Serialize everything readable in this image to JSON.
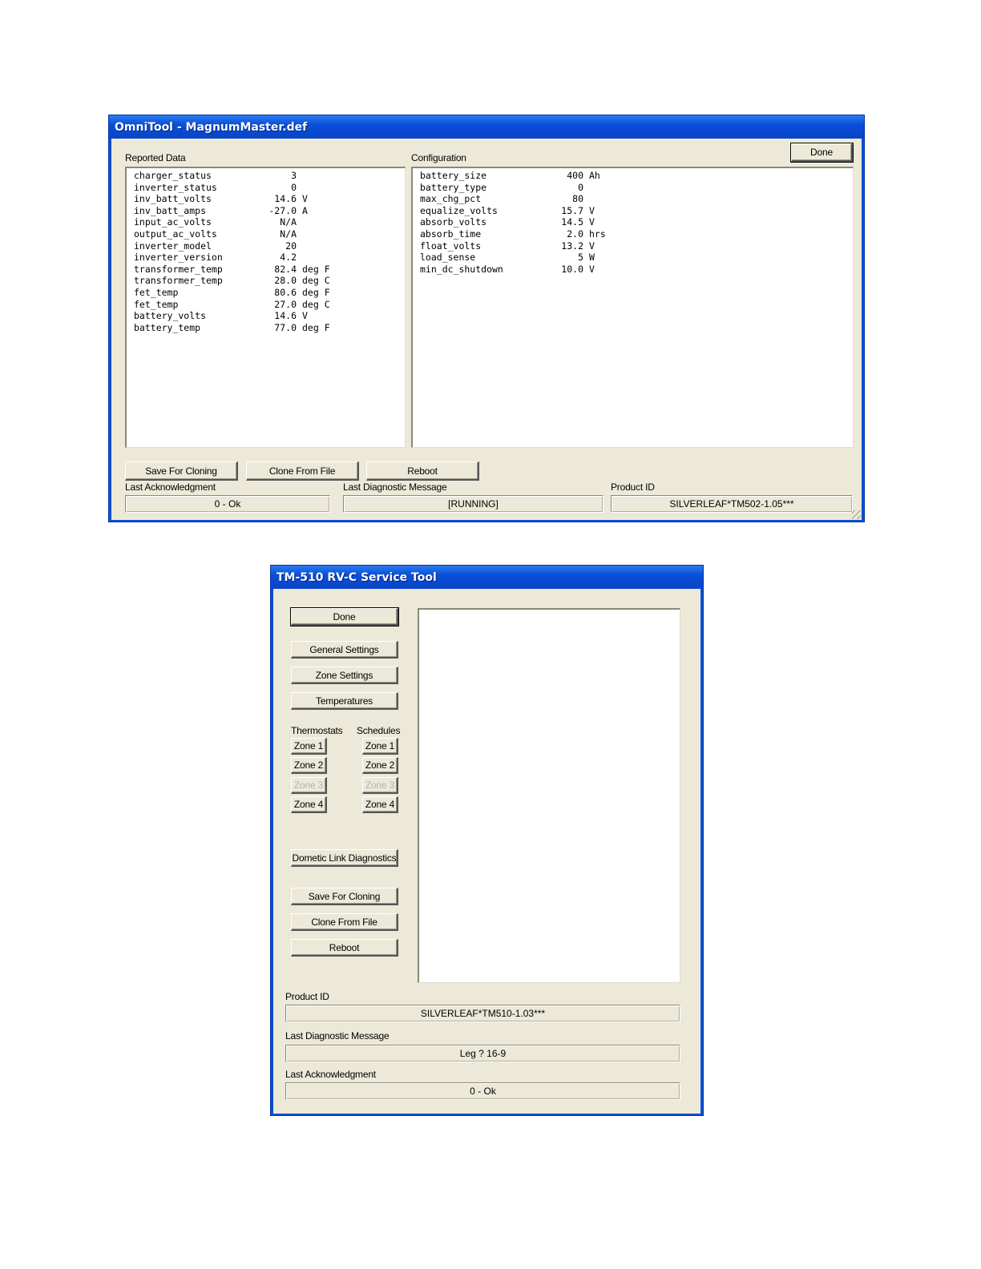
{
  "omnitool": {
    "title": "OmniTool - MagnumMaster.def",
    "reported_label": "Reported Data",
    "config_label": "Configuration",
    "done_label": "Done",
    "reported": [
      {
        "key": "charger_status",
        "value": "3",
        "unit": ""
      },
      {
        "key": "inverter_status",
        "value": "0",
        "unit": ""
      },
      {
        "key": "inv_batt_volts",
        "value": "14.6",
        "unit": "V"
      },
      {
        "key": "inv_batt_amps",
        "value": "-27.0",
        "unit": "A"
      },
      {
        "key": "input_ac_volts",
        "value": "N/A",
        "unit": ""
      },
      {
        "key": "output_ac_volts",
        "value": "N/A",
        "unit": ""
      },
      {
        "key": "inverter_model",
        "value": "20",
        "unit": ""
      },
      {
        "key": "inverter_version",
        "value": "4.2",
        "unit": ""
      },
      {
        "key": "transformer_temp",
        "value": "82.4",
        "unit": "deg F"
      },
      {
        "key": "transformer_temp",
        "value": "28.0",
        "unit": "deg C"
      },
      {
        "key": "fet_temp",
        "value": "80.6",
        "unit": "deg F"
      },
      {
        "key": "fet_temp",
        "value": "27.0",
        "unit": "deg C"
      },
      {
        "key": "battery_volts",
        "value": "14.6",
        "unit": "V"
      },
      {
        "key": "battery_temp",
        "value": "77.0",
        "unit": "deg F"
      }
    ],
    "configuration": [
      {
        "key": "battery_size",
        "value": "400",
        "unit": "Ah"
      },
      {
        "key": "battery_type",
        "value": "0",
        "unit": ""
      },
      {
        "key": "max_chg_pct",
        "value": "80",
        "unit": ""
      },
      {
        "key": "equalize_volts",
        "value": "15.7",
        "unit": "V"
      },
      {
        "key": "absorb_volts",
        "value": "14.5",
        "unit": "V"
      },
      {
        "key": "absorb_time",
        "value": "2.0",
        "unit": "hrs"
      },
      {
        "key": "float_volts",
        "value": "13.2",
        "unit": "V"
      },
      {
        "key": "load_sense",
        "value": "5",
        "unit": "W"
      },
      {
        "key": "min_dc_shutdown",
        "value": "10.0",
        "unit": "V"
      }
    ],
    "buttons": {
      "save_cloning": "Save For Cloning",
      "clone_file": "Clone From File",
      "reboot": "Reboot"
    },
    "last_ack_label": "Last Acknowledgment",
    "last_ack_value": "0 - Ok",
    "last_diag_label": "Last Diagnostic Message",
    "last_diag_value": "[RUNNING]",
    "product_id_label": "Product ID",
    "product_id_value": "SILVERLEAF*TM502-1.05***"
  },
  "tm510": {
    "title": "TM-510 RV-C Service Tool",
    "buttons": {
      "done": "Done",
      "general_settings": "General Settings",
      "zone_settings": "Zone Settings",
      "temperatures": "Temperatures",
      "dometic_link": "Dometic Link Diagnostics",
      "save_cloning": "Save For Cloning",
      "clone_file": "Clone From File",
      "reboot": "Reboot"
    },
    "thermostats_label": "Thermostats",
    "schedules_label": "Schedules",
    "thermostat_zones": [
      "Zone 1",
      "Zone 2",
      "Zone 3",
      "Zone 4"
    ],
    "schedule_zones": [
      "Zone 1",
      "Zone 2",
      "Zone 3",
      "Zone 4"
    ],
    "disabled_zone": "Zone 3",
    "product_id_label": "Product ID",
    "product_id_value": "SILVERLEAF*TM510-1.03***",
    "last_diag_label": "Last Diagnostic Message",
    "last_diag_value": "Leg ? 16-9",
    "last_ack_label": "Last Acknowledgment",
    "last_ack_value": "0 - Ok"
  }
}
